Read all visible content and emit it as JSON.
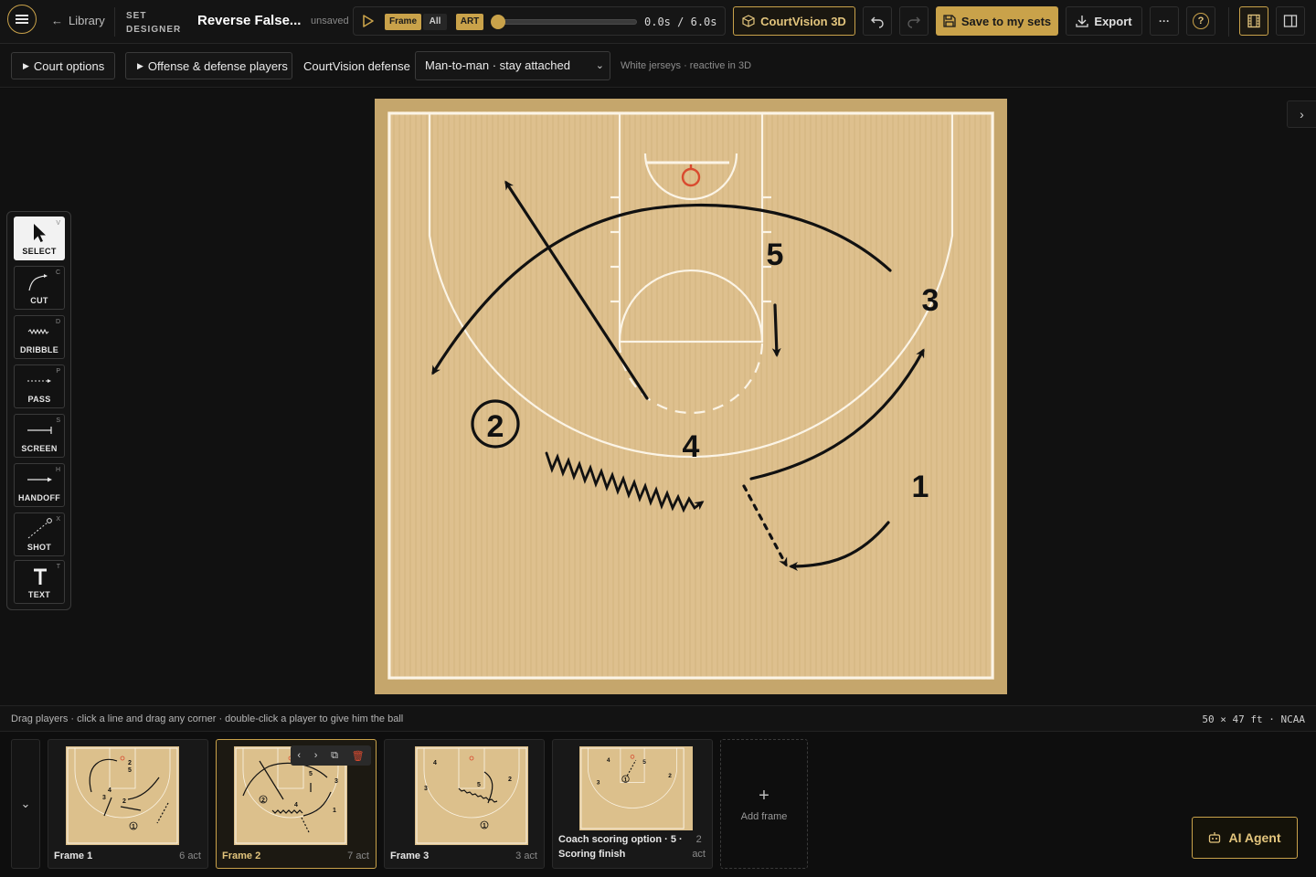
{
  "topbar": {
    "back_label": "Library",
    "product_line1": "SET",
    "product_line2": "DESIGNER",
    "play_title": "Reverse False...",
    "unsaved": "unsaved",
    "frame_pill": "Frame",
    "all_pill": "All",
    "art_pill": "ART",
    "time_current": "0.0s",
    "time_total": "6.0s",
    "time_sep": "/",
    "playhead_fraction": 0.0,
    "courtvision_3d": "CourtVision 3D",
    "save_label": "Save to my sets",
    "export_label": "Export",
    "more_label": "···",
    "help_label": "?"
  },
  "subbar": {
    "court_options": "Court options",
    "players": "Offense & defense players",
    "defense_label": "CourtVision defense",
    "defense_value": "Man-to-man · stay attached",
    "hint": "White jerseys · reactive in 3D"
  },
  "tools": [
    {
      "label": "SELECT",
      "key": "V",
      "icon": "cursor-icon",
      "active": true
    },
    {
      "label": "CUT",
      "key": "C",
      "icon": "cut-icon",
      "active": false
    },
    {
      "label": "DRIBBLE",
      "key": "D",
      "icon": "dribble-icon",
      "active": false
    },
    {
      "label": "PASS",
      "key": "P",
      "icon": "pass-icon",
      "active": false
    },
    {
      "label": "SCREEN",
      "key": "S",
      "icon": "screen-icon",
      "active": false
    },
    {
      "label": "HANDOFF",
      "key": "H",
      "icon": "handoff-icon",
      "active": false
    },
    {
      "label": "SHOT",
      "key": "X",
      "icon": "shot-icon",
      "active": false
    },
    {
      "label": "TEXT",
      "key": "T",
      "icon": "text-icon",
      "active": false
    }
  ],
  "court": {
    "players": [
      {
        "label": "5",
        "role": "offense"
      },
      {
        "label": "3",
        "role": "offense"
      },
      {
        "label": "2",
        "role": "offense-ball"
      },
      {
        "label": "4",
        "role": "offense"
      },
      {
        "label": "1",
        "role": "offense"
      }
    ]
  },
  "status": {
    "hint": "Drag players · click a line and drag any corner · double-click a player to give him the ball",
    "dims": "50 × 47 ft · NCAA"
  },
  "frames": [
    {
      "name": "Frame 1",
      "count": "6 act",
      "selected": false
    },
    {
      "name": "Frame 2",
      "count": "7 act",
      "selected": true
    },
    {
      "name": "Frame 3",
      "count": "3 act",
      "selected": false
    },
    {
      "name": "Coach scoring option · 5 · Scoring finish",
      "name_line1": "Coach scoring option · 5 ·",
      "name_line2": "Scoring finish",
      "count_line1": "2",
      "count_line2": "act",
      "selected": false
    }
  ],
  "add_frame": "Add frame",
  "ai_agent": "AI Agent",
  "colors": {
    "accent": "#c9a24a",
    "court_wood": "#dcc08c",
    "court_border": "#c5a66c",
    "basket": "#d94a2f"
  }
}
